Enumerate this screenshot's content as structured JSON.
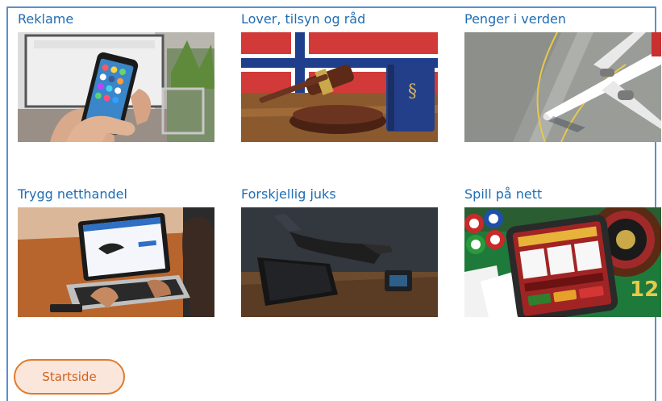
{
  "categories": [
    {
      "title": "Reklame",
      "image": "phone-social-apps-image"
    },
    {
      "title": "Lover, tilsyn og råd",
      "image": "gavel-law-book-image"
    },
    {
      "title": "Penger i verden",
      "image": "airplane-image"
    },
    {
      "title": "Trygg netthandel",
      "image": "laptop-online-shopping-image"
    },
    {
      "title": "Forskjellig juks",
      "image": "hacker-glove-laptop-image"
    },
    {
      "title": "Spill på nett",
      "image": "online-casino-image"
    }
  ],
  "footer": {
    "home_button_label": "Startside"
  },
  "colors": {
    "link": "#1f6db3",
    "frame": "#5b8fd0",
    "button_border": "#e07b2a",
    "button_fill": "#fbe6dc",
    "button_text": "#d0611d"
  }
}
